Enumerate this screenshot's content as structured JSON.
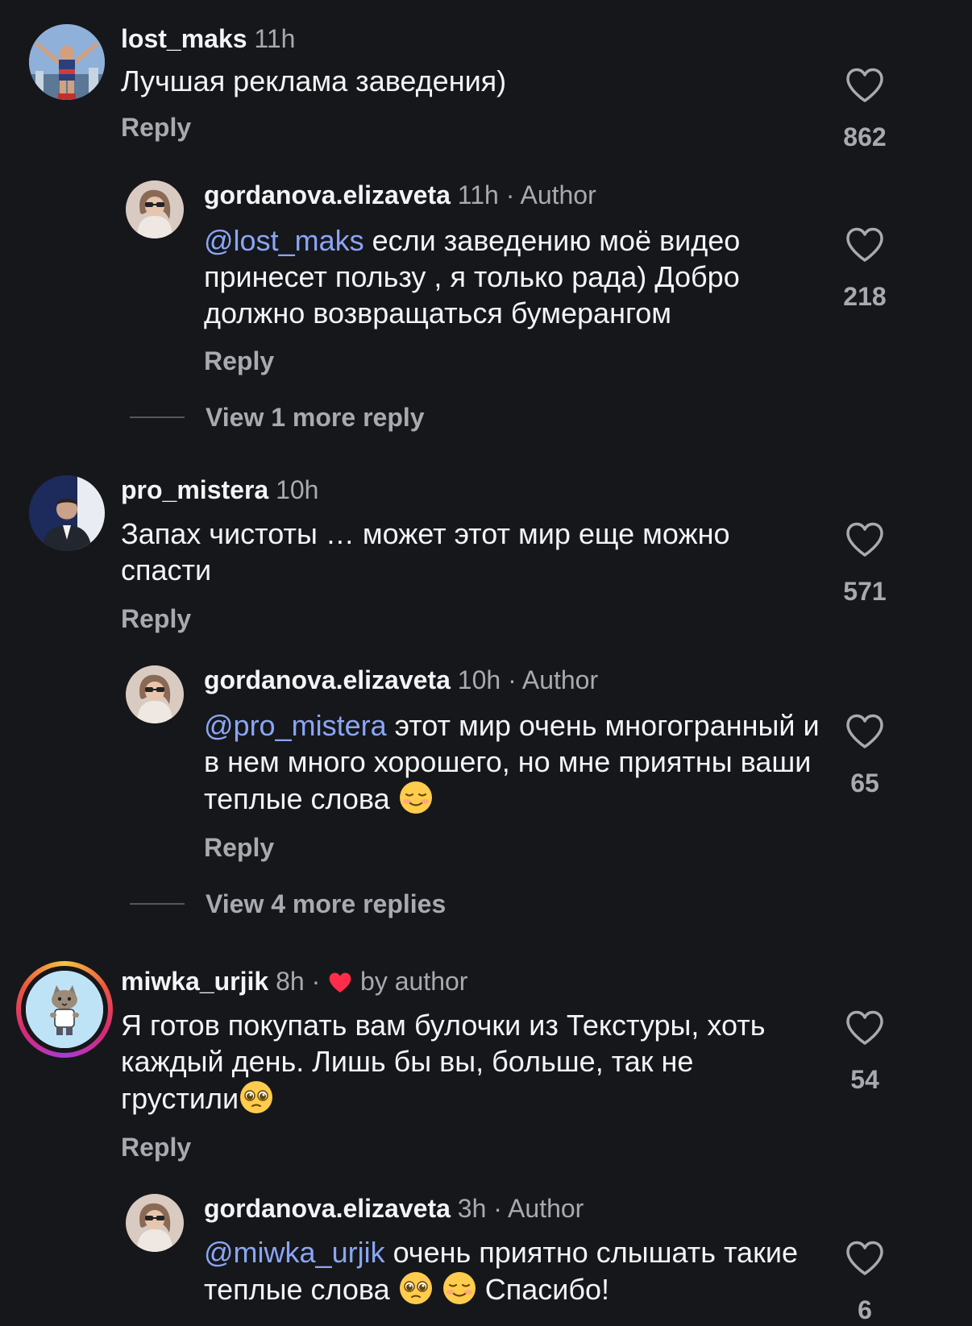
{
  "reply_label": "Reply",
  "comments": [
    {
      "username": "lost_maks",
      "time": "11h",
      "text": "Лучшая реклама заведения)",
      "likes": "862",
      "avatar_icon": "runner-photo"
    },
    {
      "username": "gordanova.elizaveta",
      "time": "11h",
      "badge": "Author",
      "mention": "@lost_maks",
      "text": " если заведению моё видео принесет пользу , я только рада) Добро должно возвращаться бумерангом",
      "likes": "218",
      "avatar_icon": "woman-photo"
    },
    {
      "view_more": "View 1 more reply"
    },
    {
      "username": "pro_mistera",
      "time": "10h",
      "text": "Запах чистоты … может этот мир еще можно спасти",
      "likes": "571",
      "avatar_icon": "man-suit-photo"
    },
    {
      "username": "gordanova.elizaveta",
      "time": "10h",
      "badge": "Author",
      "mention": "@pro_mistera",
      "text": " этот мир очень многогранный и в нем много хорошего, но мне приятны ваши теплые слова ",
      "emoji": "relieved-smile-emoji",
      "likes": "65",
      "avatar_icon": "woman-photo"
    },
    {
      "view_more": "View 4 more replies"
    },
    {
      "username": "miwka_urjik",
      "time": "8h",
      "liked_by": "by author",
      "text": "Я готов покупать вам булочки из Текстуры, хоть каждый день. Лишь бы вы, больше, так не грустили",
      "emoji": "pleading-face-emoji",
      "likes": "54",
      "avatar_icon": "cat-cartoon"
    },
    {
      "username": "gordanova.elizaveta",
      "time": "3h",
      "badge": "Author",
      "mention": "@miwka_urjik",
      "text": " очень приятно слышать такие теплые слова ",
      "emoji_tail": "Спасибо!",
      "likes": "6",
      "avatar_icon": "woman-photo"
    }
  ],
  "separator": " · ",
  "colors": {
    "background": "#16171b",
    "mention": "#8aa6f5",
    "muted": "#a8aab0",
    "like_red": "#ff2d4a"
  }
}
